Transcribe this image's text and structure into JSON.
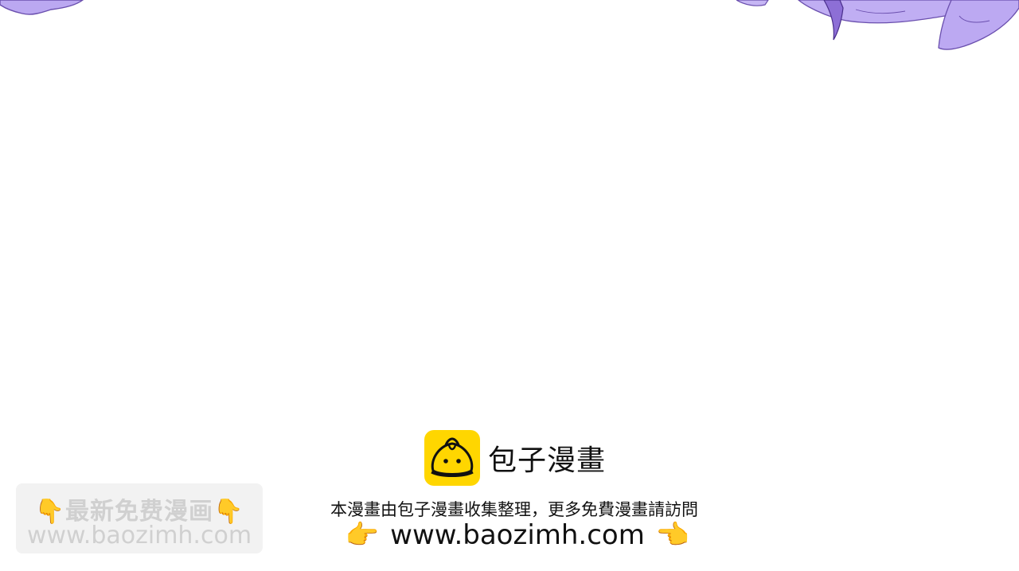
{
  "brand": {
    "name": "包子漫畫",
    "logo_color": "#ffd600"
  },
  "watermark": {
    "line1": "👇最新免费漫画👇",
    "line2": "www.baozimh.com"
  },
  "notice": {
    "text": "本漫畫由包子漫畫收集整理，更多免費漫畫請訪問"
  },
  "url": {
    "left_hand": "👉",
    "text": "www.baozimh.com",
    "right_hand": "👈"
  },
  "art": {
    "petal_color": "#b9a6ef",
    "petal_stroke": "#5b3f9e"
  }
}
